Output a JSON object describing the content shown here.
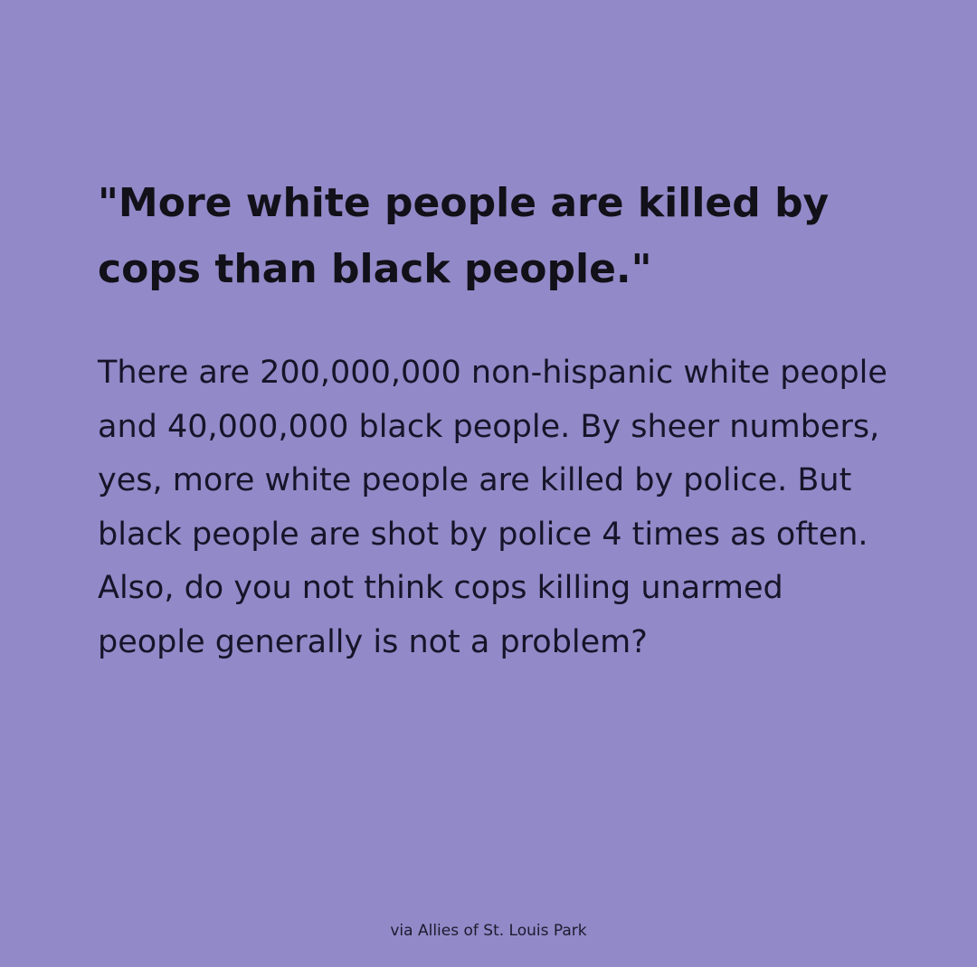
{
  "colors": {
    "background": "#9289c8",
    "text": "#151226"
  },
  "headline": "\"More white people are killed by cops than black people.\"",
  "body": "There are 200,000,000 non-hispanic white people and 40,000,000 black people. By sheer numbers, yes, more white people are killed by police. But black people are shot by police 4 times as often. Also, do you not think cops killing unarmed people generally is not a problem?",
  "credit": "via Allies of St. Louis Park"
}
